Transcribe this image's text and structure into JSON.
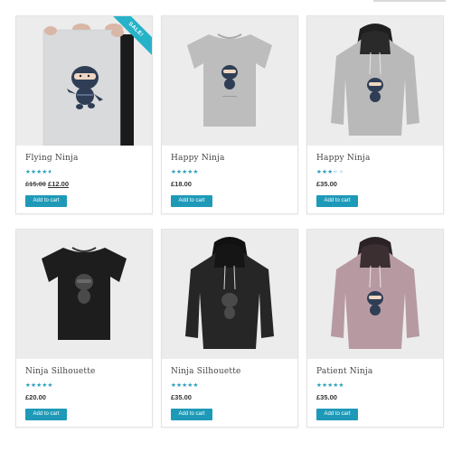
{
  "colors": {
    "accent": "#1e9ab8",
    "star": "#2a9fbd",
    "sale": "#26b3c9"
  },
  "products": [
    {
      "title": "Flying Ninja",
      "rating": 0.7,
      "old_price": "£15.00",
      "price": "£12.00",
      "on_sale": true,
      "sale_label": "SALE!",
      "button": "Add to cart",
      "image": "poster-ninja"
    },
    {
      "title": "Happy Ninja",
      "rating": 1.0,
      "price": "£18.00",
      "button": "Add to cart",
      "image": "grey-tshirt"
    },
    {
      "title": "Happy Ninja",
      "rating": 0.5,
      "price": "£35.00",
      "button": "Add to cart",
      "image": "grey-hoodie"
    },
    {
      "title": "Ninja Silhouette",
      "rating": 1.0,
      "price": "£20.00",
      "button": "Add to cart",
      "image": "black-tshirt"
    },
    {
      "title": "Ninja Silhouette",
      "rating": 0.8,
      "price": "£35.00",
      "button": "Add to cart",
      "image": "black-hoodie"
    },
    {
      "title": "Patient Ninja",
      "rating": 0.9,
      "price": "£35.00",
      "button": "Add to cart",
      "image": "pink-hoodie"
    }
  ]
}
